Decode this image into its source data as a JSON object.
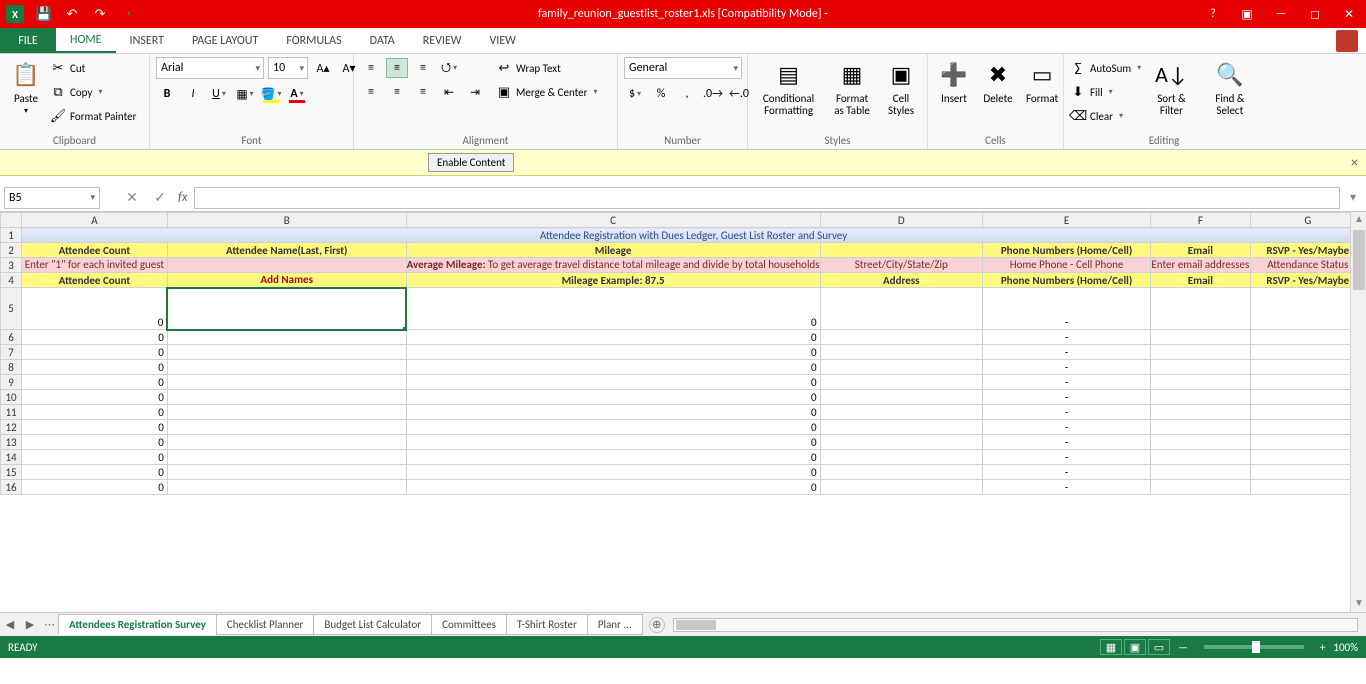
{
  "title": "family_reunion_guestlist_roster1.xls  [Compatibility Mode] -",
  "tabs": {
    "file": "FILE",
    "home": "HOME",
    "insert": "INSERT",
    "pageLayout": "PAGE LAYOUT",
    "formulas": "FORMULAS",
    "data": "DATA",
    "review": "REVIEW",
    "view": "VIEW"
  },
  "ribbon": {
    "clipboard": {
      "paste": "Paste",
      "cut": "Cut",
      "copy": "Copy",
      "formatPainter": "Format Painter",
      "label": "Clipboard"
    },
    "font": {
      "name": "Arial",
      "size": "10",
      "label": "Font"
    },
    "alignment": {
      "wrap": "Wrap Text",
      "merge": "Merge & Center",
      "label": "Alignment"
    },
    "number": {
      "format": "General",
      "label": "Number"
    },
    "styles": {
      "cf": "Conditional Formatting",
      "fat": "Format as Table",
      "cell": "Cell Styles",
      "label": "Styles"
    },
    "cells": {
      "insert": "Insert",
      "delete": "Delete",
      "format": "Format",
      "label": "Cells"
    },
    "editing": {
      "autosum": "AutoSum",
      "fill": "Fill",
      "clear": "Clear",
      "sort": "Sort & Filter",
      "find": "Find & Select",
      "label": "Editing"
    }
  },
  "msgbar": {
    "enable": "Enable Content"
  },
  "namebox": "B5",
  "columns": [
    "A",
    "B",
    "C",
    "D",
    "E",
    "F",
    "G"
  ],
  "sheet": {
    "titleRow": "Attendee Registration with Dues Ledger, Guest List Roster and Survey",
    "hdr": {
      "A": "Attendee Count",
      "B": "Attendee Name(Last, First)",
      "C": "Mileage",
      "D": "",
      "E": "Phone Numbers (Home/Cell)",
      "F": "Email",
      "G": "RSVP - Yes/Maybe"
    },
    "pink": {
      "A": "Enter \"1\" for each invited guest",
      "B": "",
      "C_bold": "Average Mileage:",
      "C_rest": " To get average travel distance total mileage and divide by total households",
      "D": "Street/City/State/Zip",
      "E": "Home Phone    -    Cell Phone",
      "F": "Enter email addresses",
      "G": "Attendance Status"
    },
    "sub": {
      "A": "Attendee Count",
      "B": "Add Names",
      "C": "Mileage Example: 87.5",
      "D": "Address",
      "E": "Phone Numbers (Home/Cell)",
      "F": "Email",
      "G": "RSVP - Yes/Maybe"
    },
    "rows": [
      5,
      6,
      7,
      8,
      9,
      10,
      11,
      12,
      13,
      14,
      15,
      16
    ],
    "valA": "0",
    "valC": "0",
    "valE": "-"
  },
  "sheetTabs": [
    "Attendees Registration Survey",
    "Checklist Planner",
    "Budget List Calculator",
    "Committees",
    "T-Shirt Roster",
    "Planr  ..."
  ],
  "status": {
    "ready": "READY",
    "zoom": "100%"
  }
}
